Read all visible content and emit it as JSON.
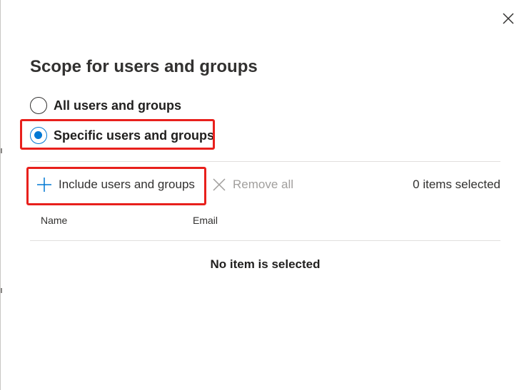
{
  "panel": {
    "title": "Scope for users and groups",
    "close_icon": "close-icon"
  },
  "scope": {
    "options": [
      {
        "label": "All users and groups",
        "selected": false
      },
      {
        "label": "Specific users and groups",
        "selected": true
      }
    ]
  },
  "toolbar": {
    "include_label": "Include users and groups",
    "include_icon": "plus-icon",
    "remove_label": "Remove all",
    "remove_icon": "close-icon",
    "selected_count": "0 items selected"
  },
  "table": {
    "columns": [
      "Name",
      "Email"
    ],
    "empty_message": "No item is selected"
  },
  "colors": {
    "accent": "#0078d4",
    "highlight": "#e8201c",
    "disabled_text": "#a19f9d"
  }
}
